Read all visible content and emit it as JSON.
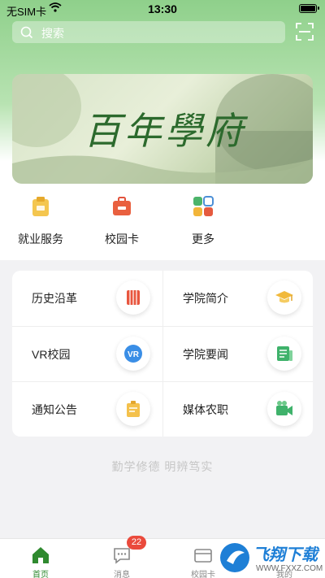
{
  "status_bar": {
    "carrier": "无SIM卡",
    "time": "13:30"
  },
  "search": {
    "placeholder": "搜索"
  },
  "banner": {
    "title": "百年學府"
  },
  "quick_actions": [
    {
      "label": "就业服务",
      "icon": "briefcase-icon"
    },
    {
      "label": "校园卡",
      "icon": "card-icon"
    },
    {
      "label": "更多",
      "icon": "grid-icon"
    }
  ],
  "menu": [
    {
      "label": "历史沿革",
      "icon": "scroll-icon"
    },
    {
      "label": "学院简介",
      "icon": "graduation-cap-icon"
    },
    {
      "label": "VR校园",
      "icon": "vr-icon"
    },
    {
      "label": "学院要闻",
      "icon": "news-icon"
    },
    {
      "label": "通知公告",
      "icon": "notice-icon"
    },
    {
      "label": "媒体农职",
      "icon": "camera-icon"
    }
  ],
  "motto": "勤学修德   明辨笃实",
  "tabbar": [
    {
      "label": "首页",
      "active": true
    },
    {
      "label": "消息",
      "badge": "22"
    },
    {
      "label": "校园卡"
    },
    {
      "label": "我的"
    }
  ],
  "watermark": {
    "brand": "飞翔下载",
    "url": "WWW.FXXZ.COM"
  },
  "colors": {
    "accent": "#2f8a2f",
    "badge": "#ea4a3c",
    "header_green": "#8fd08b"
  }
}
